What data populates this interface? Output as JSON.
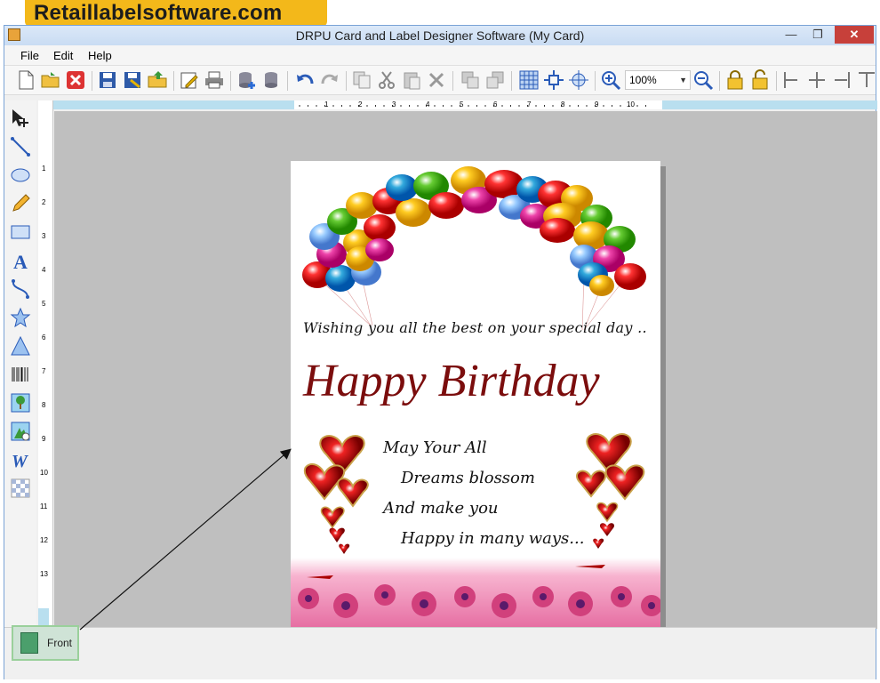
{
  "banner": {
    "text": "Retaillabelsoftware.com"
  },
  "window": {
    "title": "DRPU Card and Label Designer Software  (My Card)"
  },
  "menu": {
    "file": "File",
    "edit": "Edit",
    "help": "Help"
  },
  "toolbar": {
    "zoom_value": "100%"
  },
  "ruler": {
    "h_ticks": [
      "1",
      "2",
      "3",
      "4",
      "5",
      "6",
      "7",
      "8",
      "9",
      "10"
    ],
    "v_ticks": [
      "1",
      "2",
      "3",
      "4",
      "5",
      "6",
      "7",
      "8",
      "9",
      "10",
      "11",
      "12",
      "13"
    ]
  },
  "card": {
    "wishing": "Wishing you all the best on your special day ..",
    "headline": "Happy Birthday",
    "verse": [
      "May Your All",
      "Dreams blossom",
      "And make you",
      "Happy in many ways..."
    ]
  },
  "pages": {
    "front": "Front"
  },
  "colors": {
    "headline": "#7b0d0d",
    "titlebar": "#c9dcf3",
    "canvas": "#bfbfbf",
    "ruler": "#b9dfef",
    "banner": "#f3b81a"
  }
}
